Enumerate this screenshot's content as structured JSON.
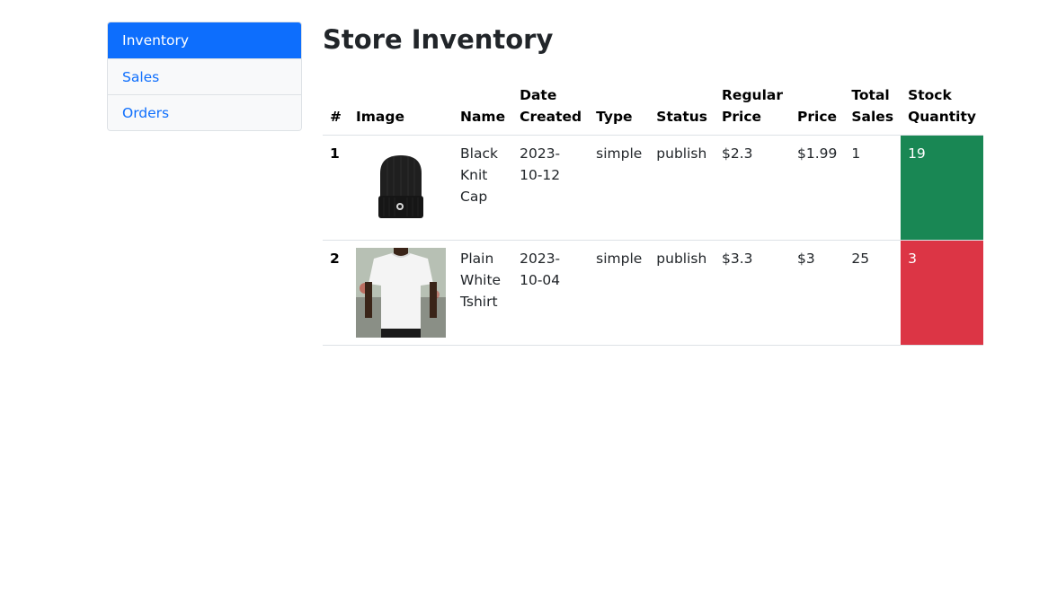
{
  "sidebar": {
    "items": [
      {
        "label": "Inventory",
        "active": true
      },
      {
        "label": "Sales",
        "active": false
      },
      {
        "label": "Orders",
        "active": false
      }
    ]
  },
  "main": {
    "title": "Store Inventory"
  },
  "table": {
    "headers": {
      "index": "#",
      "image": "Image",
      "name": "Name",
      "date_created_1": "Date",
      "date_created_2": "Created",
      "type": "Type",
      "status": "Status",
      "regular_price_1": "Regular",
      "regular_price_2": "Price",
      "price": "Price",
      "total_sales_1": "Total",
      "total_sales_2": "Sales",
      "stock_quantity_1": "Stock",
      "stock_quantity_2": "Quantity"
    },
    "rows": [
      {
        "index": "1",
        "image_icon": "black-knit-cap-image",
        "name_1": "Black",
        "name_2": "Knit",
        "name_3": "Cap",
        "date_created": "2023-10-12",
        "type": "simple",
        "status": "publish",
        "regular_price": "$2.3",
        "price": "$1.99",
        "total_sales": "1",
        "stock_quantity": "19",
        "stock_color": "#198754"
      },
      {
        "index": "2",
        "image_icon": "plain-white-tshirt-image",
        "name_1": "Plain",
        "name_2": "White",
        "name_3": "Tshirt",
        "date_created": "2023-10-04",
        "type": "simple",
        "status": "publish",
        "regular_price": "$3.3",
        "price": "$3",
        "total_sales": "25",
        "stock_quantity": "3",
        "stock_color": "#dc3545"
      }
    ]
  },
  "colors": {
    "accent": "#0d6efd",
    "stock_ok": "#198754",
    "stock_low": "#dc3545"
  }
}
